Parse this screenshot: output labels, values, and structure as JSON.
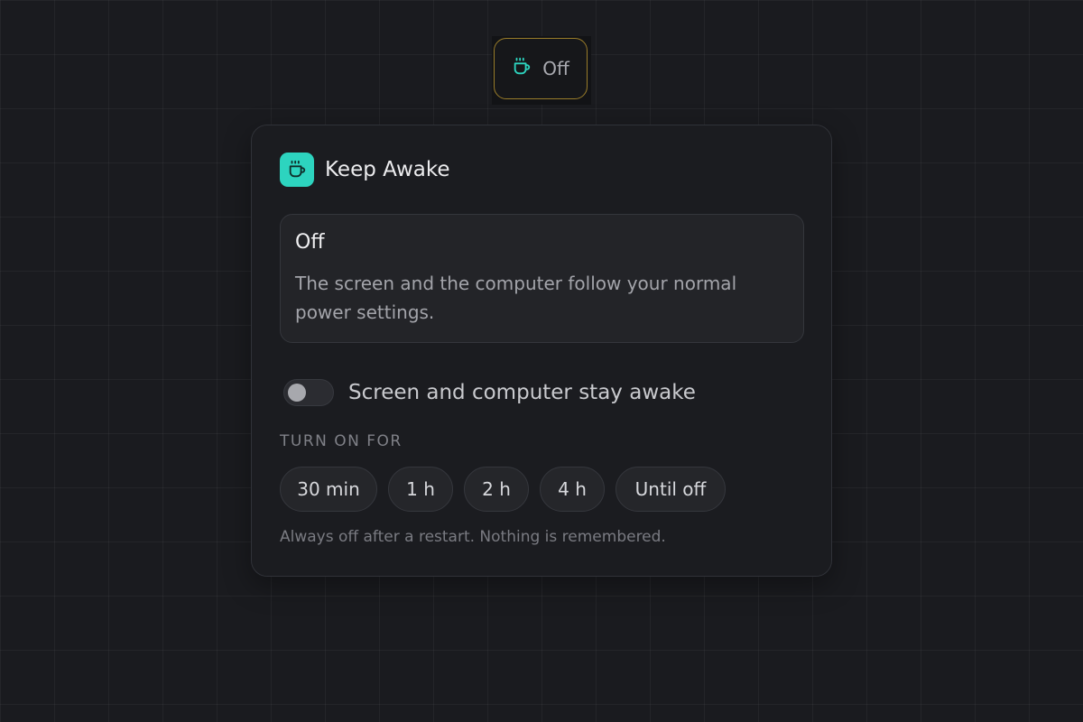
{
  "tray": {
    "icon": "coffee-cup-icon",
    "label": "Off",
    "accent_color": "#2dd4bf",
    "border_color": "#9a7d2a"
  },
  "panel": {
    "title": "Keep Awake",
    "icon": "coffee-cup-icon",
    "icon_bg_color": "#2dd4bf",
    "status": {
      "title": "Off",
      "description": "The screen and the computer follow your normal power settings."
    },
    "toggle": {
      "label": "Screen and computer stay awake",
      "state": false
    },
    "durations": {
      "label": "TURN ON FOR",
      "options": [
        "30 min",
        "1 h",
        "2 h",
        "4 h",
        "Until off"
      ]
    },
    "footnote": "Always off after a restart. Nothing is remembered."
  }
}
